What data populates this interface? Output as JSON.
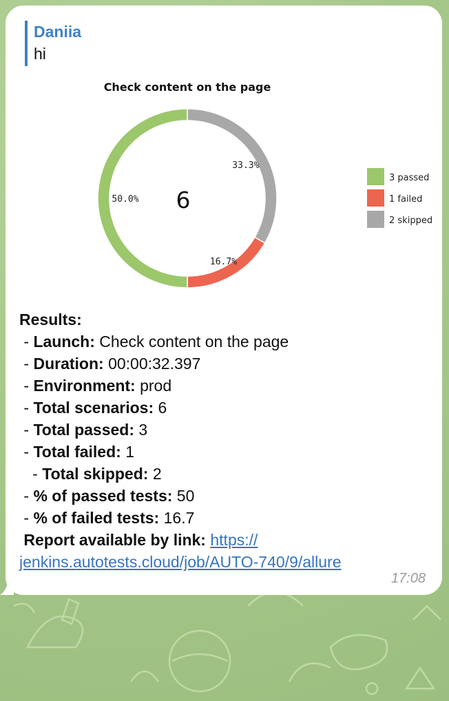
{
  "message": {
    "reply": {
      "author": "Daniia",
      "text": "hi"
    },
    "time": "17:08",
    "results": {
      "heading": "Results:",
      "launch_label": "Launch:",
      "launch_value": "Check content on the page",
      "duration_label": "Duration:",
      "duration_value": "00:00:32.397",
      "environment_label": "Environment:",
      "environment_value": "prod",
      "total_scenarios_label": "Total scenarios:",
      "total_scenarios_value": "6",
      "total_passed_label": "Total passed:",
      "total_passed_value": "3",
      "total_failed_label": "Total failed:",
      "total_failed_value": "1",
      "total_skipped_label": "Total skipped:",
      "total_skipped_value": "2",
      "pct_passed_label": "% of passed tests:",
      "pct_passed_value": "50",
      "pct_failed_label": "% of failed tests:",
      "pct_failed_value": "16.7",
      "report_label": "Report available by link:",
      "report_link": "https://jenkins.autotests.cloud/job/AUTO-740/9/allure",
      "report_link_line1": "https://",
      "report_link_line2": "jenkins.autotests.cloud/job/AUTO-740/9/allure"
    }
  },
  "chart_data": {
    "type": "pie",
    "title": "Check content on the page",
    "center_label": "6",
    "labels": [
      "passed",
      "failed",
      "skipped"
    ],
    "values": [
      3,
      1,
      2
    ],
    "percent_labels": [
      "50.0%",
      "16.7%",
      "33.3%"
    ],
    "legend": [
      "3 passed",
      "1 failed",
      "2 skipped"
    ],
    "legend_position": "right",
    "colors": {
      "passed": "#9cc76b",
      "failed": "#ec6550",
      "skipped": "#a8a8a8"
    }
  }
}
